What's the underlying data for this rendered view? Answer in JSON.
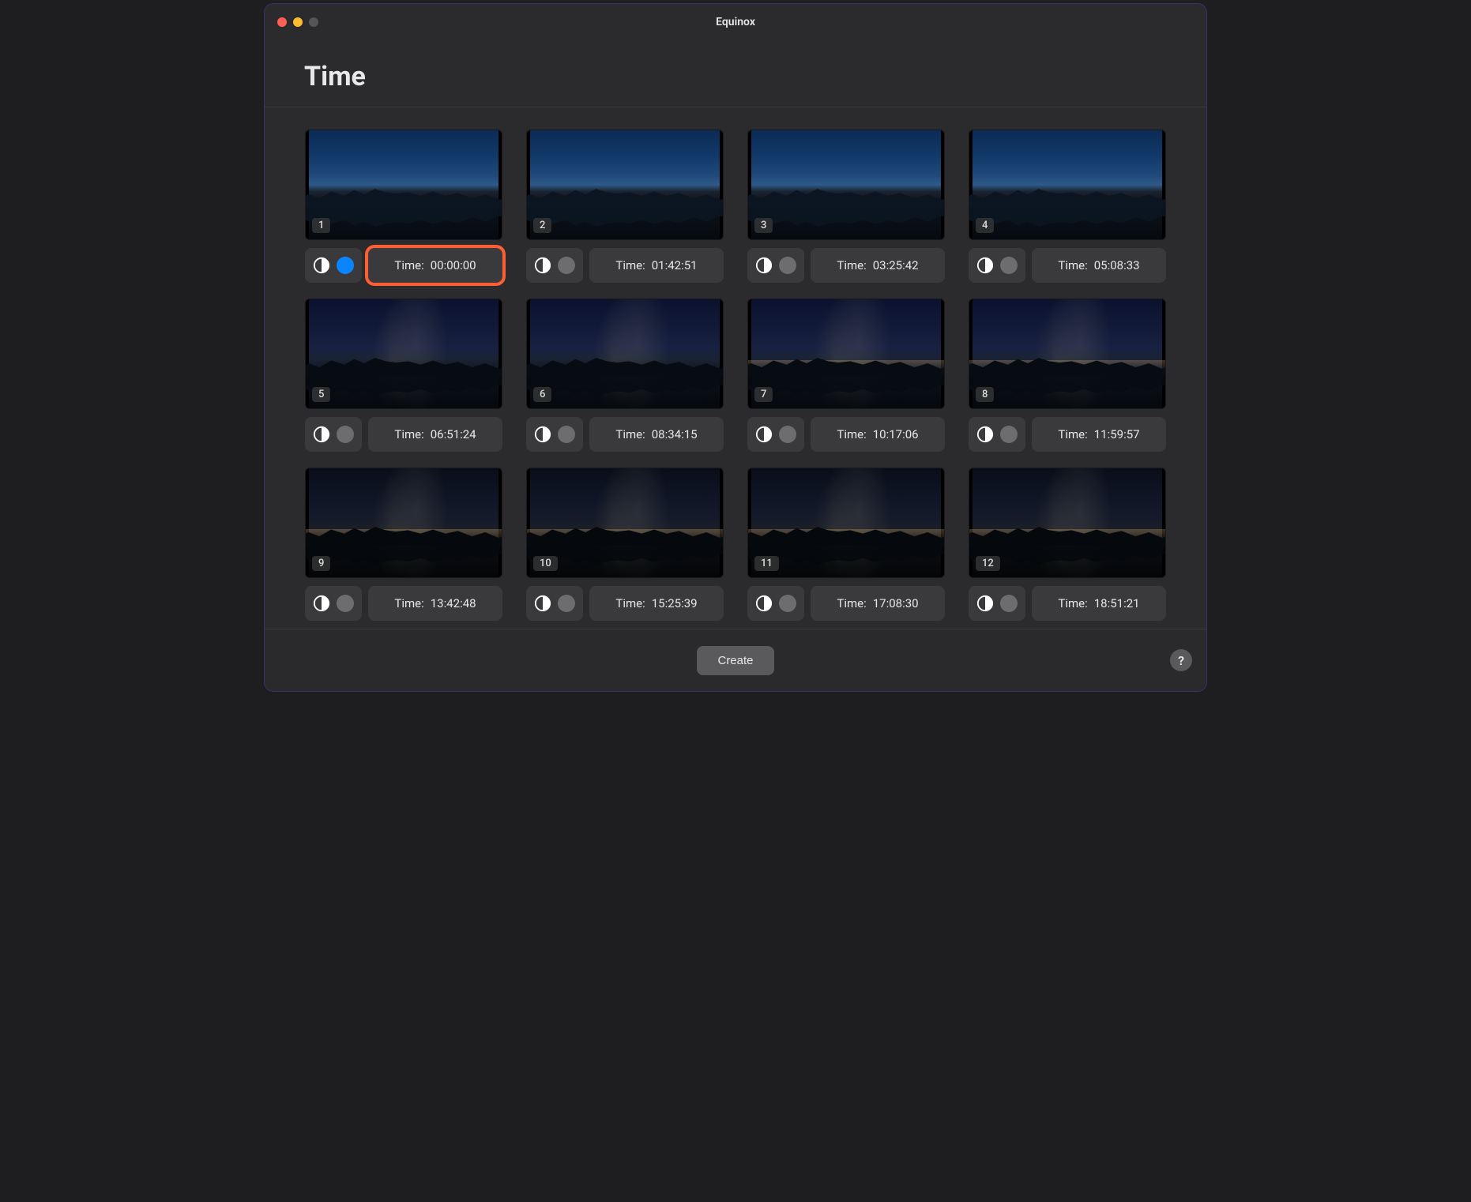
{
  "window": {
    "title": "Equinox"
  },
  "page": {
    "heading": "Time"
  },
  "time_label": "Time:",
  "footer": {
    "create_label": "Create",
    "help_label": "?"
  },
  "colors": {
    "accent": "#0a84ff",
    "highlight": "#ff5e33"
  },
  "items": [
    {
      "index": "1",
      "time": "00:00:00",
      "active": true,
      "highlight": true,
      "sky": "dusk",
      "mw": false,
      "glow": false
    },
    {
      "index": "2",
      "time": "01:42:51",
      "active": false,
      "highlight": false,
      "sky": "dusk",
      "mw": false,
      "glow": false
    },
    {
      "index": "3",
      "time": "03:25:42",
      "active": false,
      "highlight": false,
      "sky": "dusk",
      "mw": false,
      "glow": false
    },
    {
      "index": "4",
      "time": "05:08:33",
      "active": false,
      "highlight": false,
      "sky": "dusk",
      "mw": false,
      "glow": false
    },
    {
      "index": "5",
      "time": "06:51:24",
      "active": false,
      "highlight": false,
      "sky": "night1",
      "mw": true,
      "glow": false
    },
    {
      "index": "6",
      "time": "08:34:15",
      "active": false,
      "highlight": false,
      "sky": "night1",
      "mw": true,
      "glow": false
    },
    {
      "index": "7",
      "time": "10:17:06",
      "active": false,
      "highlight": false,
      "sky": "night1",
      "mw": true,
      "glow": true
    },
    {
      "index": "8",
      "time": "11:59:57",
      "active": false,
      "highlight": false,
      "sky": "night1",
      "mw": true,
      "glow": true
    },
    {
      "index": "9",
      "time": "13:42:48",
      "active": false,
      "highlight": false,
      "sky": "night2",
      "mw": true,
      "glow": true
    },
    {
      "index": "10",
      "time": "15:25:39",
      "active": false,
      "highlight": false,
      "sky": "night2",
      "mw": true,
      "glow": true
    },
    {
      "index": "11",
      "time": "17:08:30",
      "active": false,
      "highlight": false,
      "sky": "night2",
      "mw": true,
      "glow": true
    },
    {
      "index": "12",
      "time": "18:51:21",
      "active": false,
      "highlight": false,
      "sky": "night2",
      "mw": true,
      "glow": true
    }
  ]
}
